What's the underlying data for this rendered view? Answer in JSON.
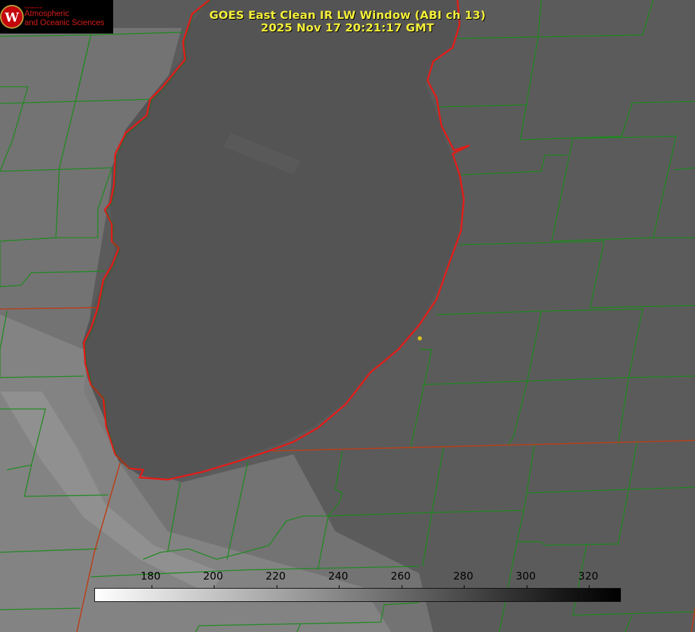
{
  "title": {
    "line1": "GOES East Clean IR LW Window (ABI ch 13)",
    "line2": "2025 Nov 17 20:21:17 GMT"
  },
  "logo": {
    "small_text": "Department of",
    "line1": "Atmospheric",
    "line2": "and Oceanic Sciences",
    "shield_letter": "W"
  },
  "colorbar": {
    "ticks": [
      "180",
      "200",
      "220",
      "240",
      "260",
      "280",
      "300",
      "320"
    ],
    "range": [
      162,
      330
    ]
  },
  "colors": {
    "title": "#f4ef3a",
    "county_lines": "#1f8a1f",
    "shoreline": "#e41b17",
    "state_lines": "#b8401a",
    "marker": "#d6c21a"
  }
}
